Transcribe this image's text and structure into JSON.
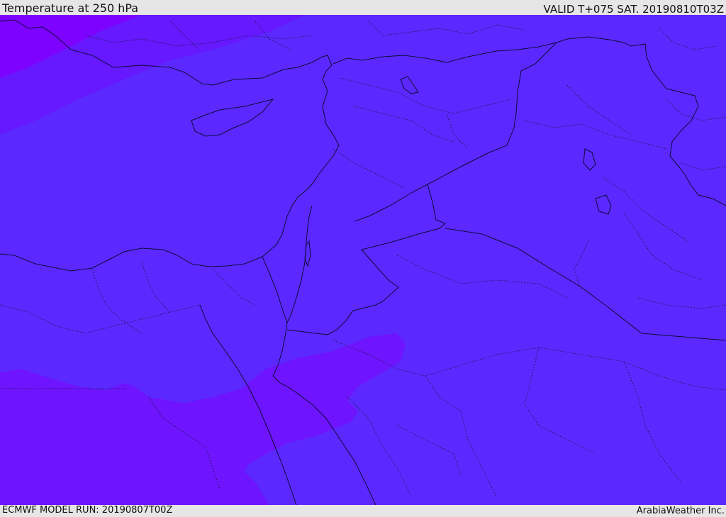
{
  "header": {
    "title": "Temperature at 250 hPa",
    "valid": "VALID T+075 SAT. 20190810T03Z"
  },
  "footer": {
    "model_run": "ECMWF MODEL RUN: 20190807T00Z",
    "credit": "ArabiaWeather Inc."
  },
  "map": {
    "colors": {
      "background": "#5b29ff",
      "warm_band": "#6e14ff",
      "coldest_zone": "#8000ff",
      "cold_zone": "#6618ff",
      "coast_and_borders": "#0d0a3a"
    }
  }
}
